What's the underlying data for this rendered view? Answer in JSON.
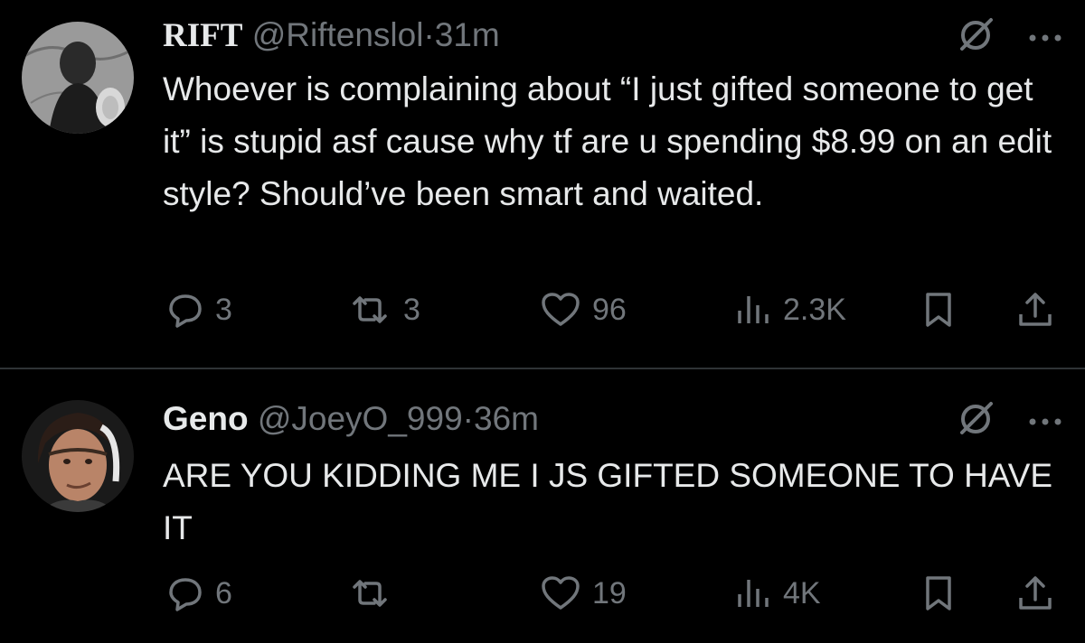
{
  "tweets": [
    {
      "name": "RIFT",
      "handle": "@Riftenslol",
      "separator": "·",
      "time": "31m",
      "text": "Whoever is complaining about “I just gifted someone to get it” is stupid asf cause why tf are u spending $8.99 on an edit style? Should’ve been smart and waited.",
      "replies": "3",
      "reposts": "3",
      "likes": "96",
      "views": "2.3K"
    },
    {
      "name": "Geno",
      "handle": "@JoeyO_999",
      "separator": "·",
      "time": "36m",
      "text": "ARE YOU KIDDING ME I JS GIFTED SOMEONE TO HAVE IT",
      "replies": "6",
      "reposts": "",
      "likes": "19",
      "views": "4K"
    }
  ],
  "icons": [
    "grok-icon",
    "more-icon",
    "reply-icon",
    "repost-icon",
    "like-icon",
    "views-icon",
    "bookmark-icon",
    "share-icon"
  ],
  "colors": {
    "background": "#000000",
    "text": "#e7e9ea",
    "muted": "#71767b",
    "divider": "#2f3336"
  }
}
